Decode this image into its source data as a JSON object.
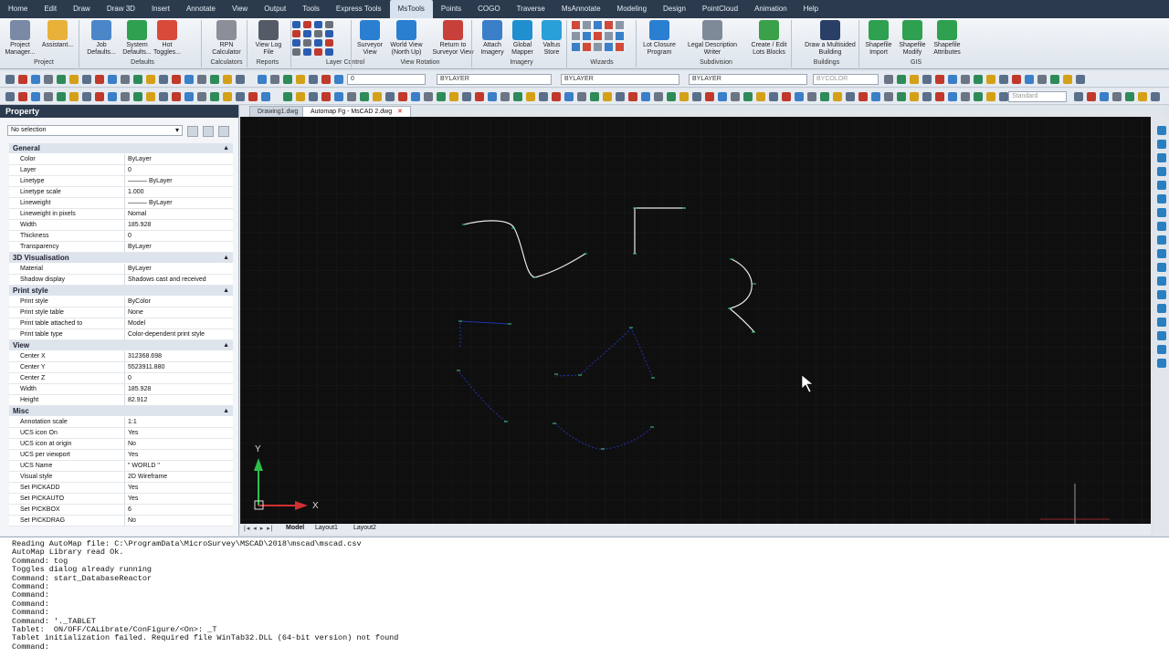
{
  "menu": {
    "tabs": [
      "Home",
      "Edit",
      "Draw",
      "Draw 3D",
      "Insert",
      "Annotate",
      "View",
      "Output",
      "Tools",
      "Express Tools",
      "MsTools",
      "Points",
      "COGO",
      "Traverse",
      "MsAnnotate",
      "Modeling",
      "Design",
      "PointCloud",
      "Animation",
      "Help"
    ],
    "active": "MsTools"
  },
  "ribbon": {
    "buttons": [
      {
        "l1": "Project",
        "l2": "Manager..."
      },
      {
        "l1": "Assistant...",
        "l2": ""
      },
      {
        "l1": "Job",
        "l2": "Defaults..."
      },
      {
        "l1": "System",
        "l2": "Defaults..."
      },
      {
        "l1": "Hot",
        "l2": "Toggles..."
      },
      {
        "l1": "RPN",
        "l2": "Calculator"
      },
      {
        "l1": "View Log",
        "l2": "File"
      },
      {
        "l1": "Surveyor",
        "l2": "View"
      },
      {
        "l1": "World View",
        "l2": "(North Up)"
      },
      {
        "l1": "Return to",
        "l2": "Surveyor View"
      },
      {
        "l1": "Attach",
        "l2": "Imagery"
      },
      {
        "l1": "Global",
        "l2": "Mapper"
      },
      {
        "l1": "Valtus",
        "l2": "Store"
      },
      {
        "l1": "Lot Closure",
        "l2": "Program"
      },
      {
        "l1": "Legal Description",
        "l2": "Writer"
      },
      {
        "l1": "Create / Edit",
        "l2": "Lots Blocks"
      },
      {
        "l1": "Draw a Multisided",
        "l2": "Building"
      },
      {
        "l1": "Shapefile",
        "l2": "Import"
      },
      {
        "l1": "Shapefile",
        "l2": "Modify"
      },
      {
        "l1": "Shapefile",
        "l2": "Attributes"
      }
    ],
    "groups": [
      "Project",
      "Defaults",
      "Calculators",
      "Reports",
      "Layer Control",
      "View Rotation",
      "Imagery",
      "Wizards",
      "Subdivision",
      "Buildings",
      "GIS"
    ]
  },
  "toolbar": {
    "layer_combo": "0",
    "color_combo": "BYLAYER",
    "linetype_combo": "BYLAYER",
    "lineweight_combo": "BYLAYER",
    "plotstyle_combo": "BYCOLOR",
    "textstyle_combo": "Standard"
  },
  "property": {
    "title": "Property",
    "selection": "No selection",
    "sections": [
      {
        "name": "General",
        "rows": [
          [
            "Color",
            "ByLayer"
          ],
          [
            "Layer",
            "0"
          ],
          [
            "Linetype",
            "——— ByLayer"
          ],
          [
            "Linetype scale",
            "1.000"
          ],
          [
            "Lineweight",
            "——— ByLayer"
          ],
          [
            "Lineweight in pixels",
            "Nomal"
          ],
          [
            "Width",
            "185.928"
          ],
          [
            "Thickness",
            "0"
          ],
          [
            "Transparency",
            "ByLayer"
          ]
        ]
      },
      {
        "name": "3D Visualisation",
        "rows": [
          [
            "Material",
            "ByLayer"
          ],
          [
            "Shadow display",
            "Shadows cast and received"
          ]
        ]
      },
      {
        "name": "Print style",
        "rows": [
          [
            "Print style",
            "ByColor"
          ],
          [
            "Print style table",
            "None"
          ],
          [
            "Print table attached to",
            "Model"
          ],
          [
            "Print table type",
            "Color-dependent print style"
          ]
        ]
      },
      {
        "name": "View",
        "rows": [
          [
            "Center X",
            "312368.698"
          ],
          [
            "Center Y",
            "5523911.880"
          ],
          [
            "Center Z",
            "0"
          ],
          [
            "Width",
            "185.928"
          ],
          [
            "Height",
            "82.912"
          ]
        ]
      },
      {
        "name": "Misc",
        "rows": [
          [
            "Annotation scale",
            "1:1"
          ],
          [
            "UCS icon On",
            "Yes"
          ],
          [
            "UCS icon at origin",
            "No"
          ],
          [
            "UCS per viewport",
            "Yes"
          ],
          [
            "UCS Name",
            "\" WORLD \""
          ],
          [
            "Visual style",
            "2D Wireframe"
          ],
          [
            "Set PICKADD",
            "Yes"
          ],
          [
            "Set PICKAUTO",
            "Yes"
          ],
          [
            "Set PICKBOX",
            "6"
          ],
          [
            "Set PICKDRAG",
            "No"
          ]
        ]
      }
    ]
  },
  "documents": {
    "tabs": [
      "Drawing1.dwg",
      "Automap Fg - MsCAD 2.dwg"
    ],
    "active": "Automap Fg - MsCAD 2.dwg"
  },
  "canvas": {
    "axis_y": "Y",
    "axis_x": "X"
  },
  "layouts": {
    "tabs": [
      "Model",
      "Layout1",
      "Layout2"
    ],
    "active": "Model"
  },
  "command": {
    "lines": [
      "Reading AutoMap file: C:\\ProgramData\\MicroSurvey\\MSCAD\\2018\\mscad\\mscad.csv",
      "AutoMap Library read Ok.",
      "Command: tog",
      "Toggles dialog already running",
      "Command: start_DatabaseReactor",
      "Command:",
      "Command:",
      "Command:",
      "Command:",
      "Command: '._TABLET",
      "Tablet:  ON/OFF/CALibrate/ConFigure/<On>: _T",
      "Tablet initialization failed. Required file WinTab32.DLL (64-bit version) not found",
      "Command:"
    ]
  },
  "colors": {
    "menubar": "#2b3a4d",
    "canvas": "#0f0f10",
    "sketch_white": "#e8e8e8",
    "sketch_blue": "#2233aa",
    "grip": "#3fcf7a"
  }
}
